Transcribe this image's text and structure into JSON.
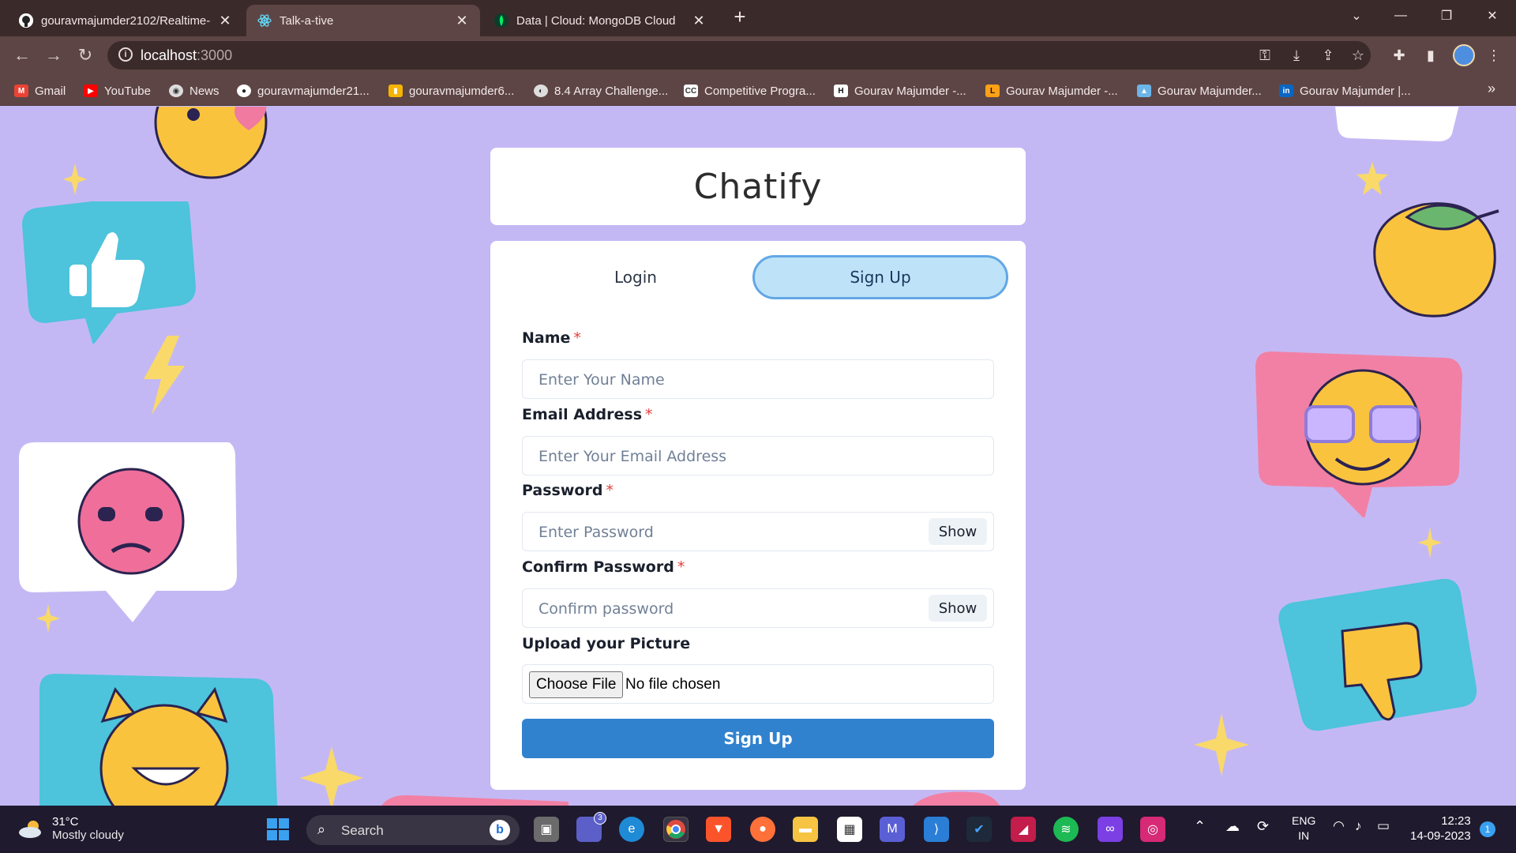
{
  "browser": {
    "tabs": [
      {
        "title": "gouravmajumder2102/Realtime-",
        "icon": "github-icon"
      },
      {
        "title": "Talk-a-tive",
        "icon": "react-icon"
      },
      {
        "title": "Data | Cloud: MongoDB Cloud",
        "icon": "mongodb-icon"
      }
    ],
    "url_host": "localhost",
    "url_port": ":3000",
    "bookmarks": [
      {
        "label": "Gmail",
        "icon": "gmail-icon",
        "color": "#ea4335"
      },
      {
        "label": "YouTube",
        "icon": "youtube-icon",
        "color": "#ff0000"
      },
      {
        "label": "News",
        "icon": "news-icon",
        "color": "#dddddd"
      },
      {
        "label": "gouravmajumder21...",
        "icon": "github-icon",
        "color": "#ffffff"
      },
      {
        "label": "gouravmajumder6...",
        "icon": "chart-icon",
        "color": "#f4b400"
      },
      {
        "label": "8.4 Array Challenge...",
        "icon": "globe-icon",
        "color": "#dddddd"
      },
      {
        "label": "Competitive Progra...",
        "icon": "cc-icon",
        "color": "#ffffff"
      },
      {
        "label": "Gourav Majumder -...",
        "icon": "hackerrank-icon",
        "color": "#2ec866"
      },
      {
        "label": "Gourav Majumder -...",
        "icon": "leetcode-icon",
        "color": "#ffa116"
      },
      {
        "label": "Gourav Majumder...",
        "icon": "mountain-icon",
        "color": "#6bb5e8"
      },
      {
        "label": "Gourav Majumder |...",
        "icon": "linkedin-icon",
        "color": "#0a66c2"
      }
    ]
  },
  "app": {
    "title": "Chatify",
    "tabs": {
      "login": "Login",
      "signup": "Sign Up"
    },
    "fields": {
      "name": {
        "label": "Name",
        "placeholder": "Enter Your Name"
      },
      "email": {
        "label": "Email Address",
        "placeholder": "Enter Your Email Address"
      },
      "password": {
        "label": "Password",
        "placeholder": "Enter Password",
        "toggle": "Show"
      },
      "confirm": {
        "label": "Confirm Password",
        "placeholder": "Confirm password",
        "toggle": "Show"
      },
      "picture": {
        "label": "Upload your Picture",
        "button": "Choose File",
        "status": "No file chosen"
      }
    },
    "required_mark": "*",
    "submit": "Sign Up",
    "colors": {
      "primary": "#3182ce",
      "tab_active_bg": "#bee3f8",
      "background": "#c4b8f4"
    }
  },
  "taskbar": {
    "weather": {
      "temp": "31°C",
      "condition": "Mostly cloudy"
    },
    "search": "Search",
    "teams_badge": "3",
    "language": "ENG",
    "region": "IN",
    "time": "12:23",
    "date": "14-09-2023",
    "notifications": "1"
  }
}
